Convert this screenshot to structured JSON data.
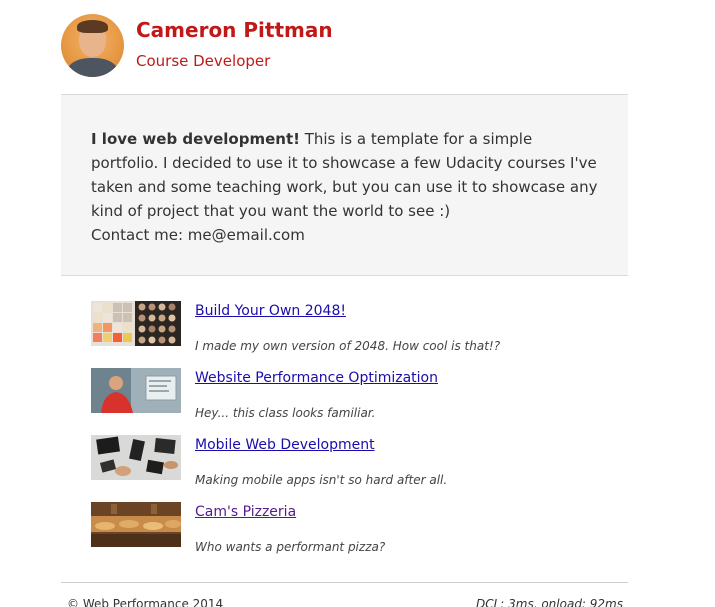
{
  "profile": {
    "name": "Cameron Pittman",
    "role": "Course Developer"
  },
  "intro": {
    "bold": "I love web development!",
    "text": " This is a template for a simple portfolio. I decided to use it to showcase a few Udacity courses I've taken and some teaching work, but you can use it to showcase any kind of project that you want the world to see :)",
    "contact": "Contact me: me@email.com"
  },
  "projects": [
    {
      "title": "Build Your Own 2048!",
      "description": "I made my own version of 2048. How cool is that!?"
    },
    {
      "title": "Website Performance Optimization",
      "description": "Hey... this class looks familiar."
    },
    {
      "title": "Mobile Web Development",
      "description": "Making mobile apps isn't so hard after all."
    },
    {
      "title": "Cam's Pizzeria",
      "description": "Who wants a performant pizza?"
    }
  ],
  "footer": {
    "copyright": "© Web Performance 2014",
    "perf": "DCL: 3ms, onload: 92ms"
  },
  "colors": {
    "accent": "#c0191a",
    "link": "#1a0dab",
    "visited": "#551a8b"
  }
}
